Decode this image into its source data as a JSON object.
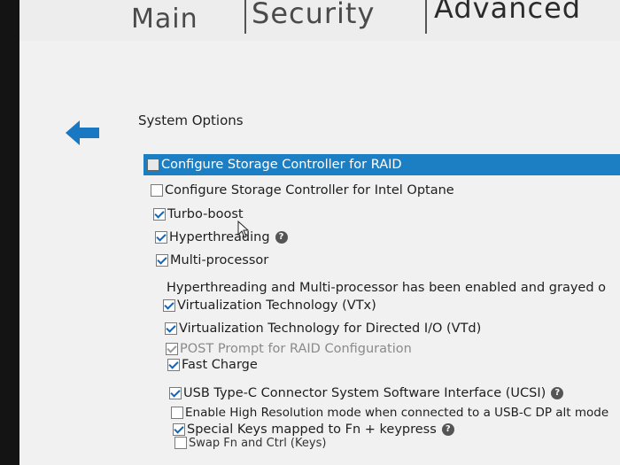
{
  "tabs": [
    {
      "label": "Main"
    },
    {
      "label": "Security"
    },
    {
      "label": "Advanced"
    }
  ],
  "section_title": "System Options",
  "icons": {
    "back": "back-arrow-icon",
    "help": "question-mark-icon",
    "cursor": "mouse-pointer-icon"
  },
  "colors": {
    "selection": "#1c7fc4",
    "check": "#1565b5"
  },
  "help_glyph": "?",
  "options": [
    {
      "label": "Configure Storage Controller for RAID",
      "checked": false
    },
    {
      "label": "Configure Storage Controller for Intel Optane",
      "checked": false
    },
    {
      "label": "Turbo-boost",
      "checked": true
    },
    {
      "label": "Hyperthreading",
      "checked": true
    },
    {
      "label": "Multi-processor",
      "checked": true
    },
    {
      "label": "Hyperthreading and Multi-processor has been enabled and grayed o"
    },
    {
      "label": "Virtualization Technology (VTx)",
      "checked": true
    },
    {
      "label": "Virtualization Technology for Directed I/O (VTd)",
      "checked": true
    },
    {
      "label": "POST Prompt for RAID Configuration",
      "checked": true
    },
    {
      "label": "Fast Charge",
      "checked": true
    },
    {
      "label": "USB Type-C Connector System Software Interface (UCSI)",
      "checked": true
    },
    {
      "label": "Enable High Resolution mode when connected to a USB-C DP alt mode",
      "checked": false
    },
    {
      "label": "Special Keys mapped to Fn + keypress",
      "checked": true
    },
    {
      "label": "Swap Fn and Ctrl (Keys)",
      "checked": false
    }
  ]
}
